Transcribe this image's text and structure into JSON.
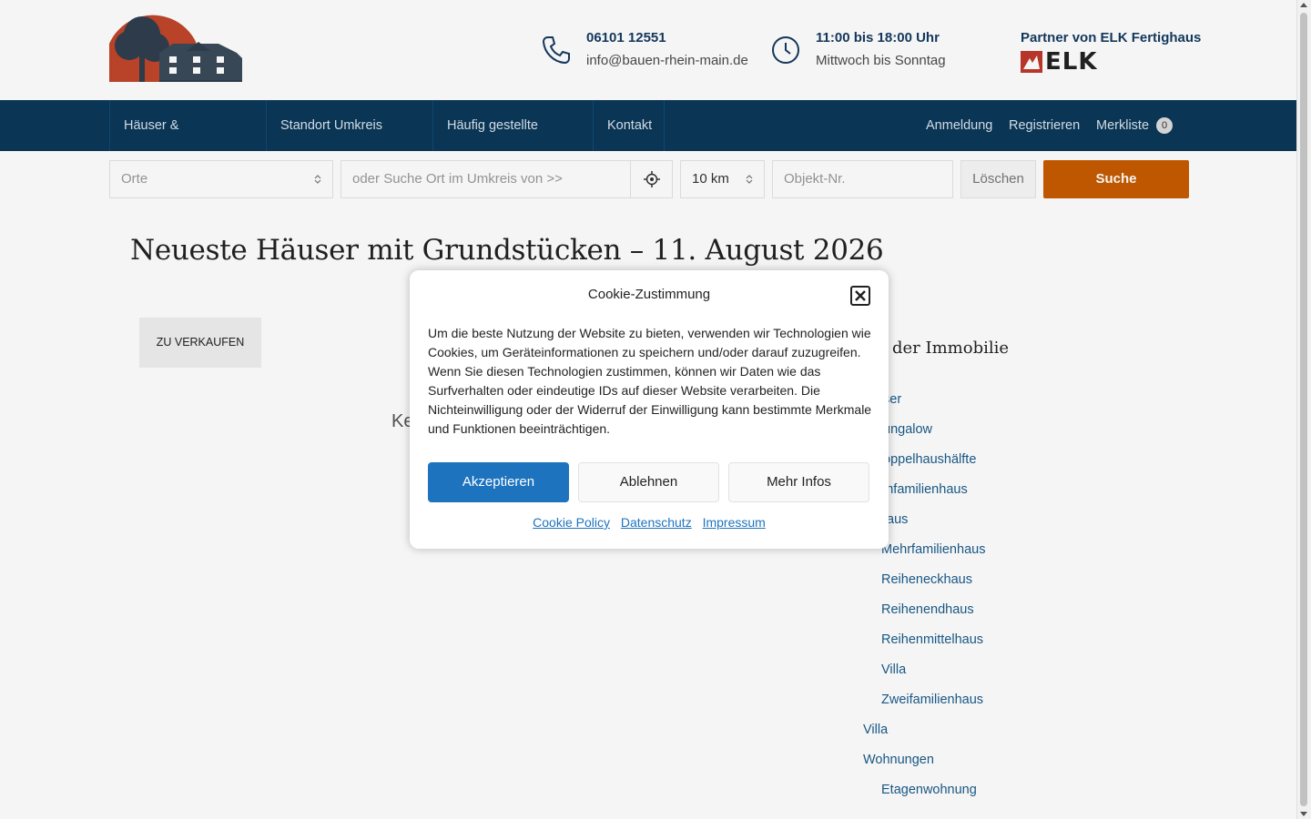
{
  "header": {
    "phone": "06101 12551",
    "email": "info@bauen-rhein-main.de",
    "hours": "11:00 bis 18:00 Uhr",
    "days": "Mittwoch bis Sonntag",
    "partner_label": "Partner von ELK Fertighaus",
    "partner_logo_text": "ELK"
  },
  "nav": {
    "items": [
      {
        "label": "Häuser & Grundstücke"
      },
      {
        "label": "Standort Umkreis Suche"
      },
      {
        "label": "Häufig gestellte Fragen"
      },
      {
        "label": "Kontakt"
      }
    ],
    "login": "Anmeldung",
    "register": "Registrieren",
    "watchlist": "Merkliste",
    "watchlist_count": "0"
  },
  "search": {
    "places_placeholder": "Orte",
    "radius_placeholder": "oder Suche Ort im Umkreis von >>",
    "radius_value": "10 km",
    "object_placeholder": "Objekt-Nr.",
    "clear_label": "Löschen",
    "submit_label": "Suche"
  },
  "page": {
    "title": "Neueste Häuser mit Grundstücken – 11. August 2026",
    "status_tab": "ZU VERKAUFEN",
    "partial_text": "Ke",
    "sidebar_title": "der Immobilie"
  },
  "categories": [
    {
      "label": "ser",
      "indent": true
    },
    {
      "label": "ungalow",
      "indent": true
    },
    {
      "label": "oppelhaushälfte",
      "indent": true
    },
    {
      "label": "infamilienhaus",
      "indent": true
    },
    {
      "label": "aus",
      "indent": true
    },
    {
      "label": "Mehrfamilienhaus",
      "indent": true
    },
    {
      "label": "Reiheneckhaus",
      "indent": true
    },
    {
      "label": "Reihenendhaus",
      "indent": true
    },
    {
      "label": "Reihenmittelhaus",
      "indent": true
    },
    {
      "label": "Villa",
      "indent": true
    },
    {
      "label": "Zweifamilienhaus",
      "indent": true
    },
    {
      "label": "Villa",
      "indent": false
    },
    {
      "label": "Wohnungen",
      "indent": false
    },
    {
      "label": "Etagenwohnung",
      "indent": true
    }
  ],
  "cookie": {
    "title": "Cookie-Zustimmung",
    "text": "Um die beste Nutzung der Website zu bieten, verwenden wir Technologien wie Cookies, um Geräteinformationen zu speichern und/oder darauf zuzugreifen. Wenn Sie diesen Technologien zustimmen, können wir Daten wie das Surfverhalten oder eindeutige IDs auf dieser Website verarbeiten. Die Nichteinwilligung oder der Widerruf der Einwilligung kann bestimmte Merkmale und Funktionen beeinträchtigen.",
    "accept": "Akzeptieren",
    "deny": "Ablehnen",
    "more": "Mehr Infos",
    "links": [
      "Cookie Policy",
      "Datenschutz",
      "Impressum"
    ]
  },
  "colors": {
    "nav_bg": "#0b3859",
    "brand_blue": "#143a5e",
    "accent_orange": "#c75b00",
    "accept_blue": "#1e73be"
  }
}
